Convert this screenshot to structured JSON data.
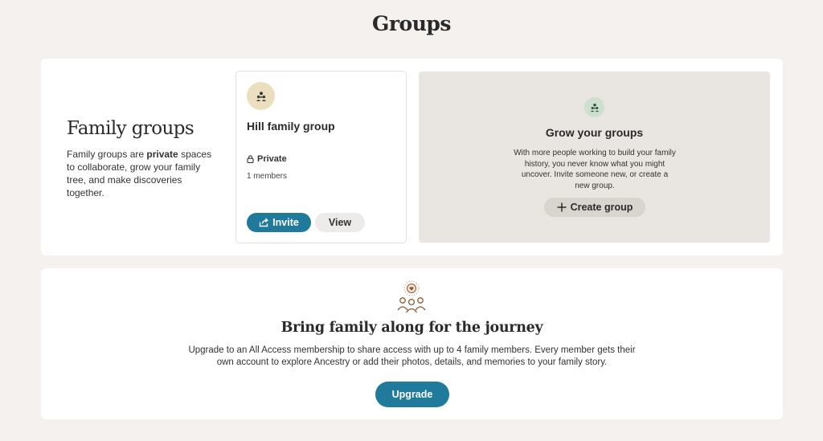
{
  "page": {
    "title": "Groups"
  },
  "intro": {
    "heading": "Family groups",
    "text_before": "Family groups are ",
    "text_bold": "private",
    "text_after": " spaces to collaborate, grow your family tree, and make discoveries together."
  },
  "group_card": {
    "name": "Hill family group",
    "privacy": "Private",
    "members": "1 members",
    "invite_label": "Invite",
    "view_label": "View",
    "avatar_color": "#ecdfc0"
  },
  "grow_card": {
    "title": "Grow your groups",
    "text": "With more people working to build your family history, you never know what you might uncover. Invite someone new, or create a new group.",
    "create_label": "Create group",
    "icon_color": "#cde0cf"
  },
  "family_panel": {
    "title": "Bring family along for the journey",
    "text": "Upgrade to an All Access membership to share access with up to 4 family members. Every member gets their own account to explore Ancestry or add their photos, details, and memories to your family story.",
    "upgrade_label": "Upgrade"
  },
  "colors": {
    "background": "#f4f1ee",
    "primary_button": "#1f7a9c",
    "grow_card_bg": "#e9e5e0"
  },
  "icons": {
    "group_avatar": "people-group-icon",
    "invite": "share-icon",
    "privacy": "lock-icon",
    "create": "plus-icon",
    "family": "family-heart-icon"
  }
}
